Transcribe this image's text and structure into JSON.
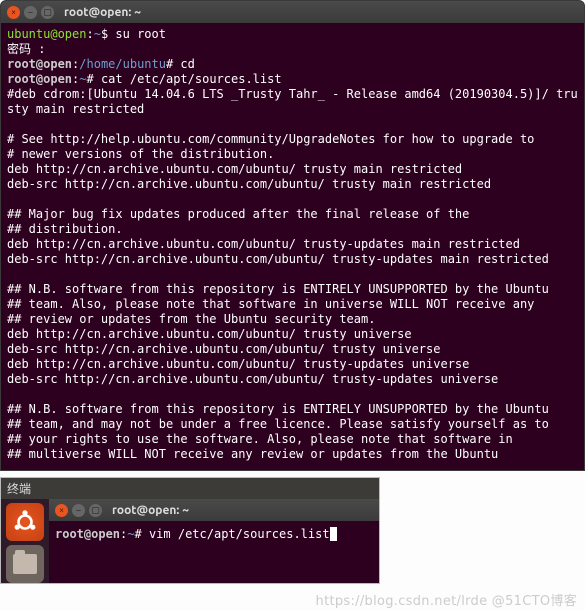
{
  "top": {
    "title": "root@open: ~",
    "lines": [
      {
        "t": "user",
        "user": "ubuntu@open",
        "path": "~",
        "sep": "$",
        "cmd": " su root"
      },
      {
        "t": "plain",
        "text": "密码 :"
      },
      {
        "t": "root",
        "user": "root@open",
        "path": "/home/ubuntu",
        "sep": "#",
        "cmd": " cd"
      },
      {
        "t": "root",
        "user": "root@open",
        "path": "~",
        "sep": "#",
        "cmd": " cat /etc/apt/sources.list"
      },
      {
        "t": "plain",
        "text": "#deb cdrom:[Ubuntu 14.04.6 LTS _Trusty Tahr_ - Release amd64 (20190304.5)]/ trusty main restricted"
      },
      {
        "t": "plain",
        "text": ""
      },
      {
        "t": "plain",
        "text": "# See http://help.ubuntu.com/community/UpgradeNotes for how to upgrade to"
      },
      {
        "t": "plain",
        "text": "# newer versions of the distribution."
      },
      {
        "t": "plain",
        "text": "deb http://cn.archive.ubuntu.com/ubuntu/ trusty main restricted"
      },
      {
        "t": "plain",
        "text": "deb-src http://cn.archive.ubuntu.com/ubuntu/ trusty main restricted"
      },
      {
        "t": "plain",
        "text": ""
      },
      {
        "t": "plain",
        "text": "## Major bug fix updates produced after the final release of the"
      },
      {
        "t": "plain",
        "text": "## distribution."
      },
      {
        "t": "plain",
        "text": "deb http://cn.archive.ubuntu.com/ubuntu/ trusty-updates main restricted"
      },
      {
        "t": "plain",
        "text": "deb-src http://cn.archive.ubuntu.com/ubuntu/ trusty-updates main restricted"
      },
      {
        "t": "plain",
        "text": ""
      },
      {
        "t": "plain",
        "text": "## N.B. software from this repository is ENTIRELY UNSUPPORTED by the Ubuntu"
      },
      {
        "t": "plain",
        "text": "## team. Also, please note that software in universe WILL NOT receive any"
      },
      {
        "t": "plain",
        "text": "## review or updates from the Ubuntu security team."
      },
      {
        "t": "plain",
        "text": "deb http://cn.archive.ubuntu.com/ubuntu/ trusty universe"
      },
      {
        "t": "plain",
        "text": "deb-src http://cn.archive.ubuntu.com/ubuntu/ trusty universe"
      },
      {
        "t": "plain",
        "text": "deb http://cn.archive.ubuntu.com/ubuntu/ trusty-updates universe"
      },
      {
        "t": "plain",
        "text": "deb-src http://cn.archive.ubuntu.com/ubuntu/ trusty-updates universe"
      },
      {
        "t": "plain",
        "text": ""
      },
      {
        "t": "plain",
        "text": "## N.B. software from this repository is ENTIRELY UNSUPPORTED by the Ubuntu"
      },
      {
        "t": "plain",
        "text": "## team, and may not be under a free licence. Please satisfy yourself as to"
      },
      {
        "t": "plain",
        "text": "## your rights to use the software. Also, please note that software in"
      },
      {
        "t": "plain",
        "text": "## multiverse WILL NOT receive any review or updates from the Ubuntu"
      }
    ]
  },
  "panel_label": "终端",
  "bottom": {
    "title": "root@open: ~",
    "prompt_user": "root@open",
    "prompt_path": "~",
    "prompt_sep": "#",
    "command": " vim /etc/apt/sources.list"
  },
  "watermark": "https://blog.csdn.net/lrde @51CTO博客"
}
